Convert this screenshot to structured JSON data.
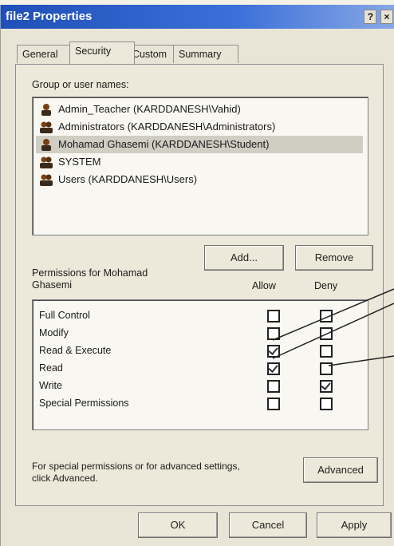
{
  "window": {
    "title": "file2 Properties",
    "help_btn": "?",
    "close_btn": "×"
  },
  "tabs": [
    {
      "label": "General"
    },
    {
      "label": "Security"
    },
    {
      "label": "Custom"
    },
    {
      "label": "Summary"
    }
  ],
  "group_label": "Group or user names:",
  "users": [
    {
      "label": "Admin_Teacher (KARDDANESH\\Vahid)",
      "icon": "user-icon"
    },
    {
      "label": "Administrators (KARDDANESH\\Administrators)",
      "icon": "group-icon"
    },
    {
      "label": "Mohamad Ghasemi (KARDDANESH\\Student)",
      "icon": "user-icon",
      "selected": true
    },
    {
      "label": "SYSTEM",
      "icon": "group-icon"
    },
    {
      "label": "Users (KARDDANESH\\Users)",
      "icon": "group-icon"
    }
  ],
  "buttons": {
    "add": "Add...",
    "remove": "Remove",
    "advanced": "Advanced",
    "ok": "OK",
    "cancel": "Cancel",
    "apply": "Apply"
  },
  "permissions_label_line1": "Permissions for Mohamad",
  "permissions_label_line2": "Ghasemi",
  "col_allow": "Allow",
  "col_deny": "Deny",
  "permissions": [
    {
      "name": "Full Control",
      "allow": false,
      "deny": false
    },
    {
      "name": "Modify",
      "allow": false,
      "deny": false
    },
    {
      "name": "Read & Execute",
      "allow": true,
      "deny": false
    },
    {
      "name": "Read",
      "allow": true,
      "deny": false
    },
    {
      "name": "Write",
      "allow": false,
      "deny": true
    },
    {
      "name": "Special Permissions",
      "allow": false,
      "deny": false
    }
  ],
  "advanced_note_line1": "For special permissions or for advanced settings,",
  "advanced_note_line2": "click Advanced."
}
